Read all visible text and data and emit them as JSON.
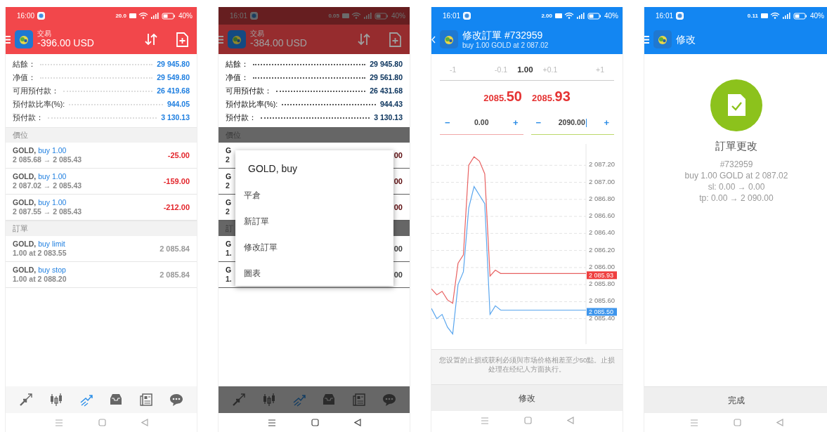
{
  "screens": [
    {
      "kind": "account",
      "dimmed": false,
      "status_bar": {
        "time": "16:00",
        "net_speed": "20.0",
        "battery": "40%"
      },
      "header": {
        "title": "交易",
        "profit": "-396.00 USD"
      },
      "summary": [
        {
          "label": "結餘：",
          "value": "29 945.80"
        },
        {
          "label": "净值：",
          "value": "29 549.80"
        },
        {
          "label": "可用預付款：",
          "value": "26 419.68"
        },
        {
          "label": "預付款比率(%):",
          "value": "944.05"
        },
        {
          "label": "預付款：",
          "value": "3 130.13"
        }
      ],
      "sections": [
        {
          "title": "價位",
          "items": [
            {
              "kind": "trade",
              "symbol": "GOLD,",
              "deal": "buy 1.00",
              "prices": "2 085.68 → 2 085.43",
              "amount": "-25.00",
              "loss": true
            },
            {
              "kind": "trade",
              "symbol": "GOLD,",
              "deal": "buy 1.00",
              "prices": "2 087.02 → 2 085.43",
              "amount": "-159.00",
              "loss": true
            },
            {
              "kind": "trade",
              "symbol": "GOLD,",
              "deal": "buy 1.00",
              "prices": "2 087.55 → 2 085.43",
              "amount": "-212.00",
              "loss": true
            }
          ]
        },
        {
          "title": "訂單",
          "items": [
            {
              "kind": "trade",
              "symbol": "GOLD,",
              "deal": "buy limit",
              "prices": "1.00 at 2 083.55",
              "amount": "2 085.84",
              "loss": false
            },
            {
              "kind": "trade",
              "symbol": "GOLD,",
              "deal": "buy stop",
              "prices": "1.00 at 2 088.20",
              "amount": "2 085.84",
              "loss": false
            }
          ]
        }
      ],
      "bottom_nav": [
        {
          "kind": "quotes",
          "selected": false
        },
        {
          "kind": "chart",
          "selected": false
        },
        {
          "kind": "trade",
          "selected": true
        },
        {
          "kind": "history",
          "selected": false
        },
        {
          "kind": "news",
          "selected": false
        },
        {
          "kind": "messages",
          "selected": false
        }
      ]
    },
    {
      "kind": "account",
      "dimmed": true,
      "status_bar": {
        "time": "16:01",
        "net_speed": "0.05",
        "battery": "40%"
      },
      "header": {
        "title": "交易",
        "profit": "-384.00 USD"
      },
      "summary": [
        {
          "label": "結餘：",
          "value": "29 945.80"
        },
        {
          "label": "净值：",
          "value": "29 561.80"
        },
        {
          "label": "可用預付款：",
          "value": "26 431.68"
        },
        {
          "label": "預付款比率(%):",
          "value": "944.43"
        },
        {
          "label": "預付款：",
          "value": "3 130.13"
        }
      ],
      "sections": [
        {
          "title": "價位",
          "items": [
            {
              "kind": "peek",
              "symbol": "G",
              "prices": "2",
              "amount": "00",
              "loss": true
            },
            {
              "kind": "peek",
              "symbol": "G",
              "prices": "2",
              "amount": "00",
              "loss": true
            },
            {
              "kind": "peek",
              "symbol": "G",
              "prices": "2",
              "amount": "00",
              "loss": true
            }
          ]
        },
        {
          "title": "訂",
          "items": [
            {
              "kind": "peek",
              "symbol": "G",
              "prices": "1.",
              "amount": "00",
              "loss": false
            },
            {
              "kind": "peek",
              "symbol": "G",
              "prices": "1.",
              "amount": "00",
              "loss": false
            }
          ]
        }
      ],
      "dialog": {
        "title": "GOLD, buy",
        "items": [
          "平倉",
          "新訂單",
          "修改訂單",
          "圖表"
        ]
      },
      "bottom_nav": [
        {
          "kind": "quotes",
          "selected": false
        },
        {
          "kind": "chart",
          "selected": false
        },
        {
          "kind": "trade",
          "selected": true
        },
        {
          "kind": "history",
          "selected": false
        },
        {
          "kind": "news",
          "selected": false
        },
        {
          "kind": "messages",
          "selected": false
        }
      ]
    },
    {
      "kind": "modify_order",
      "status_bar": {
        "time": "16:01",
        "net_speed": "2.00",
        "battery": "40%"
      },
      "header": {
        "title": "修改訂單 #732959",
        "subtitle": "buy 1.00 GOLD at 2 087.02"
      },
      "volume": [
        {
          "kind": "step",
          "text": "-1"
        },
        {
          "kind": "step",
          "text": "-0.1"
        },
        {
          "kind": "value",
          "text": "1.00"
        },
        {
          "kind": "step",
          "text": "+0.1"
        },
        {
          "kind": "step",
          "text": "+1"
        }
      ],
      "prices": [
        {
          "head": "2085.",
          "pips": "50"
        },
        {
          "head": "2085.",
          "pips": "93"
        }
      ],
      "stops": [
        {
          "kind": "sl",
          "minus": "−",
          "value": "0.00",
          "plus": "+",
          "focused": false
        },
        {
          "kind": "tp",
          "minus": "−",
          "value": "2090.00",
          "plus": "+",
          "focused": true
        }
      ],
      "chart": {
        "chart_data": {
          "type": "line",
          "series": [
            {
              "color": "#e86262",
              "values": [
                2085.75,
                2085.68,
                2085.72,
                2085.62,
                2085.58,
                2086.05,
                2086.15,
                2087.2,
                2087.3,
                2087.25,
                2087.1,
                2085.9,
                2085.97,
                2085.93,
                2085.93,
                2085.93,
                2085.93,
                2085.93,
                2085.93,
                2085.93,
                2085.93,
                2085.93,
                2085.93,
                2085.93,
                2085.93,
                2085.93,
                2085.93,
                2085.93,
                2085.93,
                2085.93
              ]
            },
            {
              "color": "#5aa6ee",
              "values": [
                2085.52,
                2085.4,
                2085.45,
                2085.3,
                2085.22,
                2085.8,
                2085.95,
                2086.7,
                2086.95,
                2086.85,
                2086.75,
                2085.45,
                2085.55,
                2085.5,
                2085.5,
                2085.5,
                2085.5,
                2085.5,
                2085.5,
                2085.5,
                2085.5,
                2085.5,
                2085.5,
                2085.5,
                2085.5,
                2085.5,
                2085.5,
                2085.5,
                2085.5,
                2085.5
              ]
            }
          ],
          "grid": true,
          "ylim": [
            2085.1,
            2087.45
          ],
          "yticks": [
            {
              "value": 2087.2,
              "label": "2 087.20"
            },
            {
              "value": 2087.0,
              "label": "2 087.00"
            },
            {
              "value": 2086.8,
              "label": "2 086.80"
            },
            {
              "value": 2086.6,
              "label": "2 086.60"
            },
            {
              "value": 2086.4,
              "label": "2 086.40"
            },
            {
              "value": 2086.2,
              "label": "2 086.20"
            },
            {
              "value": 2086.0,
              "label": "2 086.00"
            },
            {
              "value": 2085.8,
              "label": "2 085.80"
            },
            {
              "value": 2085.6,
              "label": "2 085.60"
            },
            {
              "value": 2085.4,
              "label": "2 085.40"
            }
          ],
          "annotations": [
            "2 085.93",
            "2 085.50"
          ]
        }
      },
      "notice": "您设置的止损或获利必须與市场价格相差至少50點。止损处理在经纪人方面执行。",
      "action": "修改"
    },
    {
      "kind": "result",
      "status_bar": {
        "time": "16:01",
        "net_speed": "0.11",
        "battery": "40%"
      },
      "header": {
        "title": "修改"
      },
      "heading": "訂單更改",
      "details": [
        "#732959",
        "buy 1.00 GOLD at 2 087.02",
        "sl: 0.00 → 0.00",
        "tp: 0.00 → 2 090.00"
      ],
      "action": "完成"
    }
  ]
}
